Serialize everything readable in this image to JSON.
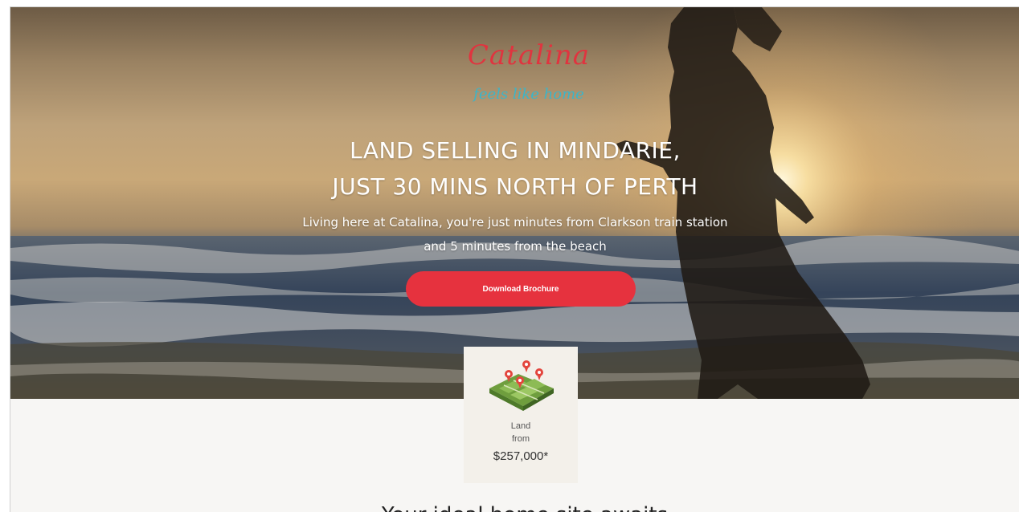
{
  "brand": {
    "name": "Catalina",
    "tagline": "feels like home",
    "accent": "#e6323e",
    "tagline_color": "#3bb5c9"
  },
  "hero": {
    "headline_line1": "LAND SELLING IN MINDARIE,",
    "headline_line2": "JUST 30 MINS NORTH OF PERTH",
    "sub_line1": "Living here at Catalina, you're just minutes from Clarkson train station",
    "sub_line2": "and 5 minutes from the beach",
    "cta_label": "Download Brochure"
  },
  "price_card": {
    "icon": "land-map-icon",
    "line1": "Land",
    "line2": "from",
    "price": "$257,000*"
  },
  "next_section": {
    "heading": "Your ideal home site awaits"
  }
}
